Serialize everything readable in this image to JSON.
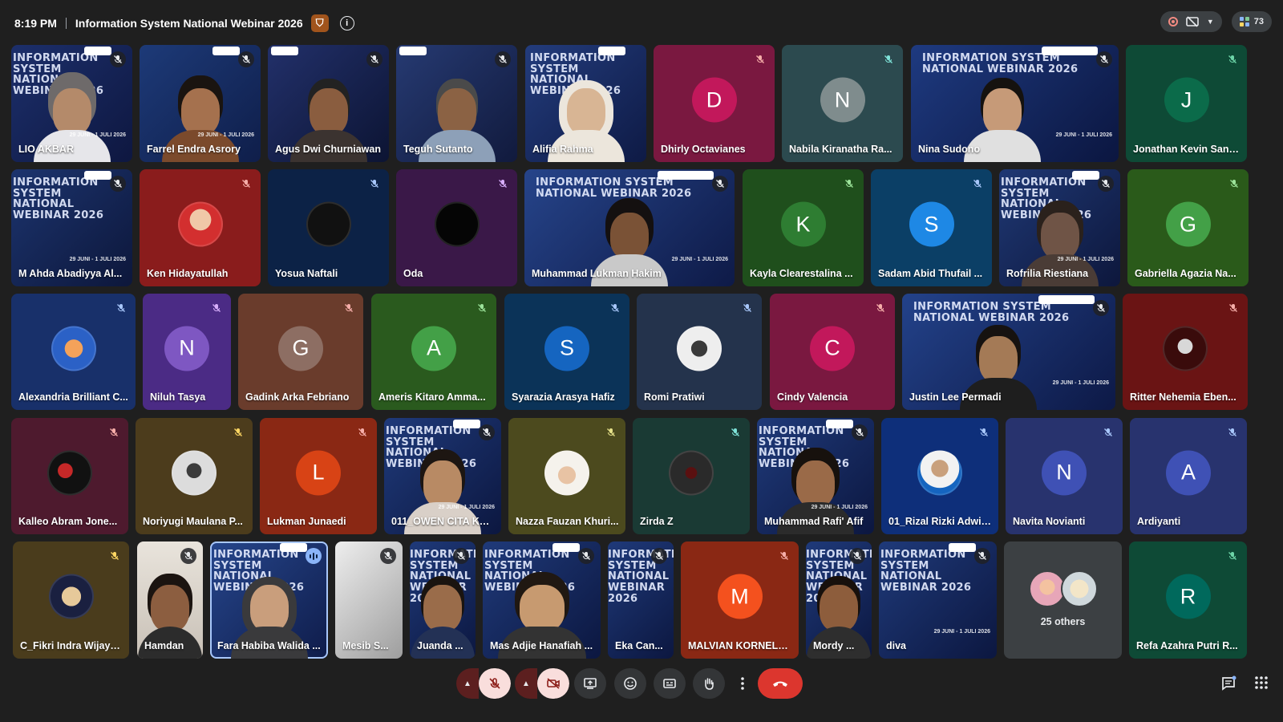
{
  "meeting": {
    "time": "8:19 PM",
    "title": "Information System National Webinar 2026",
    "participant_count": "73"
  },
  "icons": {
    "host": "host-badge-icon",
    "info": "info-icon",
    "recording": "recording-icon",
    "layout_present": "present-off-icon",
    "people": "people-icon",
    "chat": "chat-icon",
    "activities": "activities-grid-icon"
  },
  "colors": {
    "background": "#1f1f1f",
    "end_call": "#dc362e",
    "mic_off_tile": "#f9dedc",
    "speaking_ring": "#a8c7fa"
  },
  "banner": {
    "line1": "INFORMATION SYSTEM",
    "line2": "NATIONAL WEBINAR 2026",
    "date": "29 JUNI - 1 JULI 2026"
  },
  "others": {
    "label": "25 others"
  },
  "participants": [
    {
      "name": "LIO AKBAR"
    },
    {
      "name": "Farrel Endra Asrory"
    },
    {
      "name": "Agus Dwi Churniawan"
    },
    {
      "name": "Teguh Sutanto"
    },
    {
      "name": "Alifia Rahma"
    },
    {
      "name": "Dhirly Octavianes",
      "initial": "D"
    },
    {
      "name": "Nabila Kiranatha Ra...",
      "initial": "N"
    },
    {
      "name": "Nina Sudono"
    },
    {
      "name": "Jonathan Kevin Sant...",
      "initial": "J"
    },
    {
      "name": "M Ahda Abadiyya Al..."
    },
    {
      "name": "Ken Hidayatullah"
    },
    {
      "name": "Yosua Naftali"
    },
    {
      "name": "Oda"
    },
    {
      "name": "Muhammad Lukman Hakim"
    },
    {
      "name": "Kayla Clearestalina ...",
      "initial": "K"
    },
    {
      "name": "Sadam Abid Thufail ...",
      "initial": "S"
    },
    {
      "name": "Rofrilia Riestiana"
    },
    {
      "name": "Gabriella Agazia Na...",
      "initial": "G"
    },
    {
      "name": "Alexandria Brilliant C..."
    },
    {
      "name": "Niluh Tasya",
      "initial": "N"
    },
    {
      "name": "Gadink Arka Febriano",
      "initial": "G"
    },
    {
      "name": "Ameris Kitaro Amma...",
      "initial": "A"
    },
    {
      "name": "Syarazia Arasya Hafiz",
      "initial": "S"
    },
    {
      "name": "Romi Pratiwi"
    },
    {
      "name": "Cindy Valencia",
      "initial": "C"
    },
    {
      "name": "Justin Lee Permadi"
    },
    {
      "name": "Ritter Nehemia Eben..."
    },
    {
      "name": "Kalleo Abram Jone..."
    },
    {
      "name": "Noriyugi Maulana P..."
    },
    {
      "name": "Lukman Junaedi",
      "initial": "L"
    },
    {
      "name": "011_OWEN CITA KA..."
    },
    {
      "name": "Nazza Fauzan Khuri..."
    },
    {
      "name": "Zirda Z"
    },
    {
      "name": "Muhammad Rafi' Afif"
    },
    {
      "name": "01_Rizal Rizki Adwit..."
    },
    {
      "name": "Navita Novianti",
      "initial": "N"
    },
    {
      "name": "Ardiyanti",
      "initial": "A"
    },
    {
      "name": "C_Fikri Indra Wijaya..."
    },
    {
      "name": "Hamdan"
    },
    {
      "name": "Fara Habiba Walida ..."
    },
    {
      "name": "Mesib S..."
    },
    {
      "name": "Juanda ..."
    },
    {
      "name": "Mas Adjie Hanafiah ..."
    },
    {
      "name": "Eka Can..."
    },
    {
      "name": "MALVIAN KORNELL...",
      "initial": "M"
    },
    {
      "name": "Mordy ..."
    },
    {
      "name": "diva"
    },
    {
      "name": "Refa Azahra Putri R...",
      "initial": "R"
    }
  ],
  "controls": [
    {
      "name": "mic-options",
      "icon": "chevron-up-icon"
    },
    {
      "name": "microphone",
      "icon": "mic-off-icon",
      "state": "off"
    },
    {
      "name": "camera-options",
      "icon": "chevron-up-icon"
    },
    {
      "name": "camera",
      "icon": "camera-off-icon",
      "state": "off"
    },
    {
      "name": "present",
      "icon": "present-screen-icon"
    },
    {
      "name": "reactions",
      "icon": "emoji-icon"
    },
    {
      "name": "captions",
      "icon": "captions-icon"
    },
    {
      "name": "raise-hand",
      "icon": "hand-icon"
    },
    {
      "name": "more-options",
      "icon": "more-vert-icon"
    },
    {
      "name": "leave-call",
      "icon": "call-end-icon"
    }
  ]
}
